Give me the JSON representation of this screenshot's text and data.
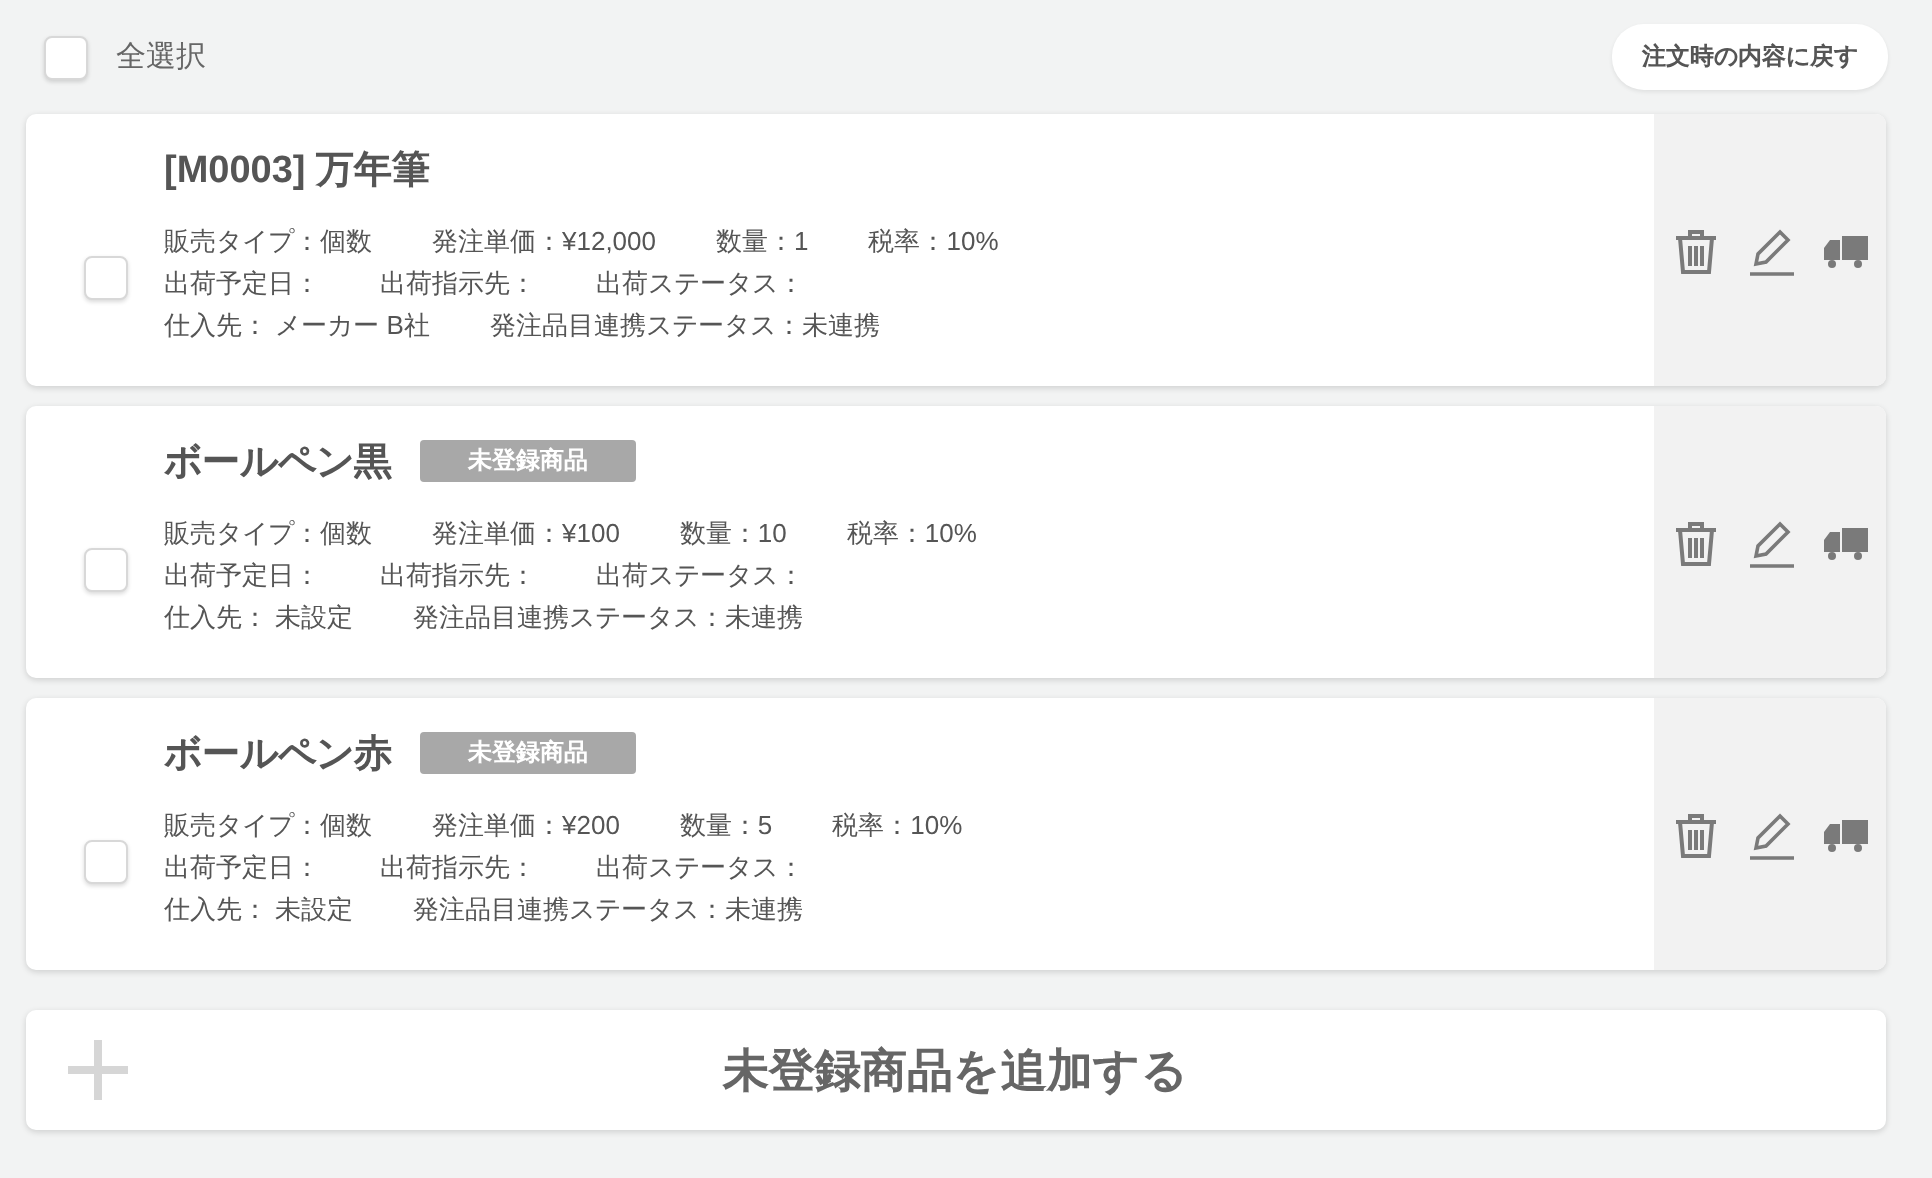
{
  "select_all": {
    "label": "全選択",
    "checked": false
  },
  "revert_button": "注文時の内容に戻す",
  "items": [
    {
      "title": "[M0003] 万年筆",
      "checked": false,
      "lines": [
        [
          "販売タイプ：個数",
          "発注単価：¥12,000",
          "数量：1",
          "税率：10%"
        ],
        [
          "出荷予定日：",
          "出荷指示先：",
          "出荷ステータス："
        ],
        [
          "仕入先： メーカー B社",
          "発注品目連携ステータス：未連携"
        ]
      ]
    },
    {
      "title": "ボールペン黒",
      "badge": "未登録商品",
      "checked": false,
      "lines": [
        [
          "販売タイプ：個数",
          "発注単価：¥100",
          "数量：10",
          "税率：10%"
        ],
        [
          "出荷予定日：",
          "出荷指示先：",
          "出荷ステータス："
        ],
        [
          "仕入先： 未設定",
          "発注品目連携ステータス：未連携"
        ]
      ]
    },
    {
      "title": "ボールペン赤",
      "badge": "未登録商品",
      "checked": false,
      "lines": [
        [
          "販売タイプ：個数",
          "発注単価：¥200",
          "数量：5",
          "税率：10%"
        ],
        [
          "出荷予定日：",
          "出荷指示先：",
          "出荷ステータス："
        ],
        [
          "仕入先： 未設定",
          "発注品目連携ステータス：未連携"
        ]
      ]
    }
  ],
  "add_button": "未登録商品を追加する"
}
